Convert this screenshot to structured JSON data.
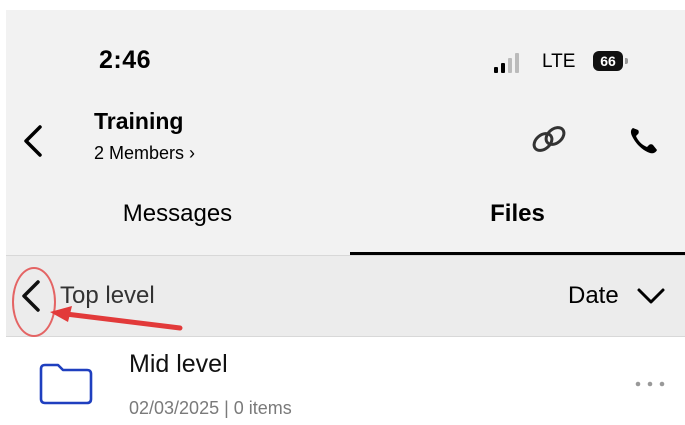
{
  "status_bar": {
    "time": "2:46",
    "network": "LTE",
    "battery": "66"
  },
  "header": {
    "title": "Training",
    "members_label": "2 Members ›",
    "back_icon": "chevron-left-icon",
    "link_icon": "link-icon",
    "phone_icon": "phone-icon"
  },
  "tabs": [
    {
      "label": "Messages",
      "selected": false
    },
    {
      "label": "Files",
      "selected": true
    }
  ],
  "folder_nav": {
    "current_level": "Top level",
    "sort_label": "Date",
    "sort_icon": "chevron-down-icon"
  },
  "files": [
    {
      "name": "Mid level",
      "meta": "02/03/2025 | 0 items",
      "icon": "folder-icon"
    }
  ],
  "colors": {
    "accent_blue": "#1f3fbf",
    "annotation_red": "#e46464",
    "header_bg": "#f2f2f2"
  }
}
